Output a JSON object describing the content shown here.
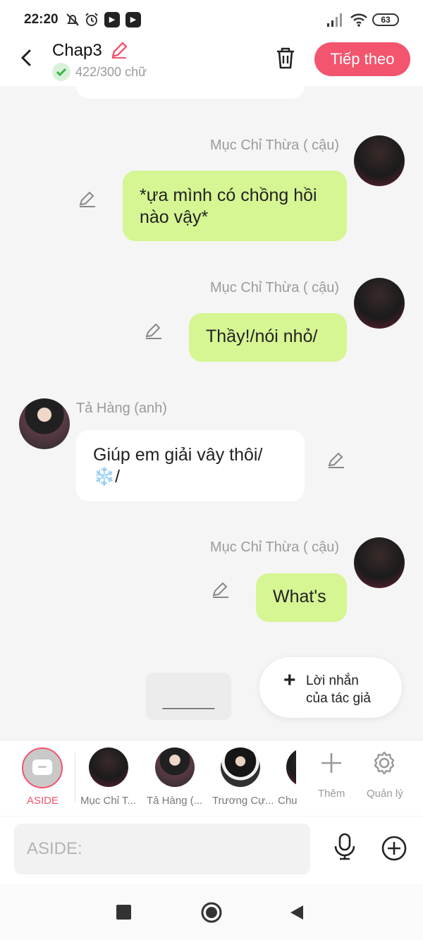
{
  "status_bar": {
    "time": "22:20",
    "battery": "63"
  },
  "header": {
    "title": "Chap3",
    "word_count": "422/300 chữ",
    "next_label": "Tiếp theo"
  },
  "messages": [
    {
      "speaker": "Mục Chỉ Thừa ( cậu)",
      "text": "*ựa mình có chồng hồi nào vậy*"
    },
    {
      "speaker": "Mục Chỉ Thừa ( cậu)",
      "text": "Thầy!/nói nhỏ/"
    },
    {
      "speaker": "Tả Hàng (anh)",
      "text": "Giúp em giải vây thôi/ ❄️/"
    },
    {
      "speaker": "Mục Chỉ Thừa ( cậu)",
      "text": "What's"
    }
  ],
  "aside_placeholder": "______",
  "author_note": {
    "line1": "Lời nhắn",
    "line2": "của tác giả"
  },
  "character_bar": {
    "aside_label": "ASIDE",
    "characters": [
      "Mục Chỉ T...",
      "Tả Hàng (...",
      "Trương Cự...",
      "Chu"
    ],
    "add_label": "Thêm",
    "manage_label": "Quản lý"
  },
  "input": {
    "placeholder": "ASIDE:"
  },
  "colors": {
    "accent": "#f3546e",
    "bubble_green": "#d6f593",
    "background": "#f5f5f5"
  }
}
